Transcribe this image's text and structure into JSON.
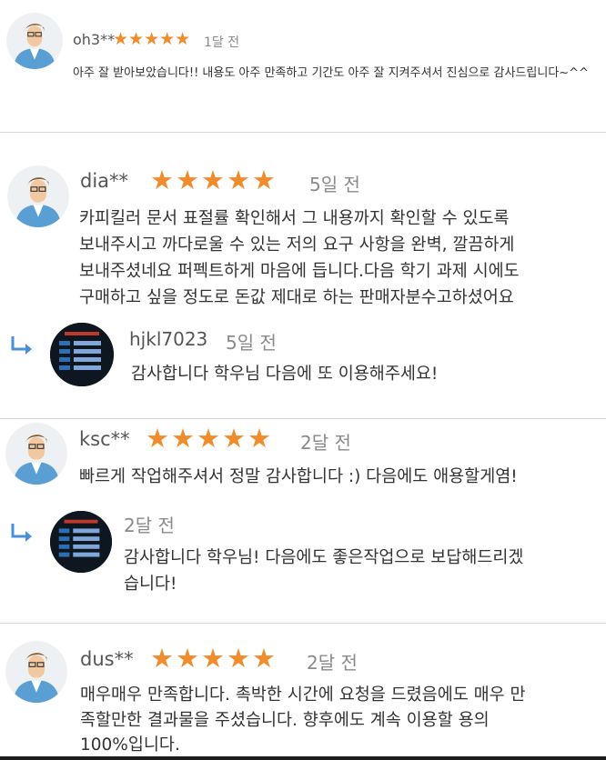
{
  "colors": {
    "star": "#f08c2c",
    "text": "#333333",
    "muted": "#8a8a8a",
    "divider": "#d7d7d7"
  },
  "icons": {
    "avatar": "user-avatar-icon",
    "reply": "reply-arrow-icon",
    "seller_avatar": "seller-avatar-icon",
    "star": "star-icon"
  },
  "reviews": [
    {
      "author": "oh3**",
      "stars": "★★★★★",
      "rating": 5,
      "date": "1달 전",
      "lines": [
        "아주 잘 받아보았습니다!! 내용도 아주 만족하고 기간도 아주 잘 지켜주셔서 진심으로 감사드립니다~^^"
      ]
    },
    {
      "author": "dia**",
      "stars": "★★★★★",
      "rating": 5,
      "date": "5일 전",
      "lines": [
        "카피킬러 문서 표절률 확인해서 그 내용까지 확인할 수 있도록",
        "보내주시고 까다로울 수 있는 저의 요구 사항을 완벽, 깔끔하게",
        "보내주셨네요 퍼펙트하게 마음에 듭니다.다음 학기 과제 시에도",
        "구매하고 싶을 정도로 돈값 제대로 하는 판매자분수고하셨어요"
      ],
      "reply": {
        "author": "hjkl7023",
        "date": "5일 전",
        "lines": [
          "감사합니다 학우님 다음에 또 이용해주세요!"
        ]
      }
    },
    {
      "author": "ksc**",
      "stars": "★★★★★",
      "rating": 5,
      "date": "2달 전",
      "lines": [
        "빠르게 작업해주셔서 정말 감사합니다 :) 다음에도 애용할게염!"
      ],
      "reply": {
        "date": "2달 전",
        "lines": [
          "감사합니다 학우님! 다음에도 좋은작업으로 보답해드리겠",
          "습니다!"
        ]
      }
    },
    {
      "author": "dus**",
      "stars": "★★★★★",
      "rating": 5,
      "date": "2달 전",
      "lines": [
        "매우매우 만족합니다. 촉박한 시간에 요청을 드렸음에도 매우 만",
        "족할만한 결과물을 주셨습니다. 향후에도 계속 이용할 용의",
        "100%입니다."
      ]
    }
  ]
}
